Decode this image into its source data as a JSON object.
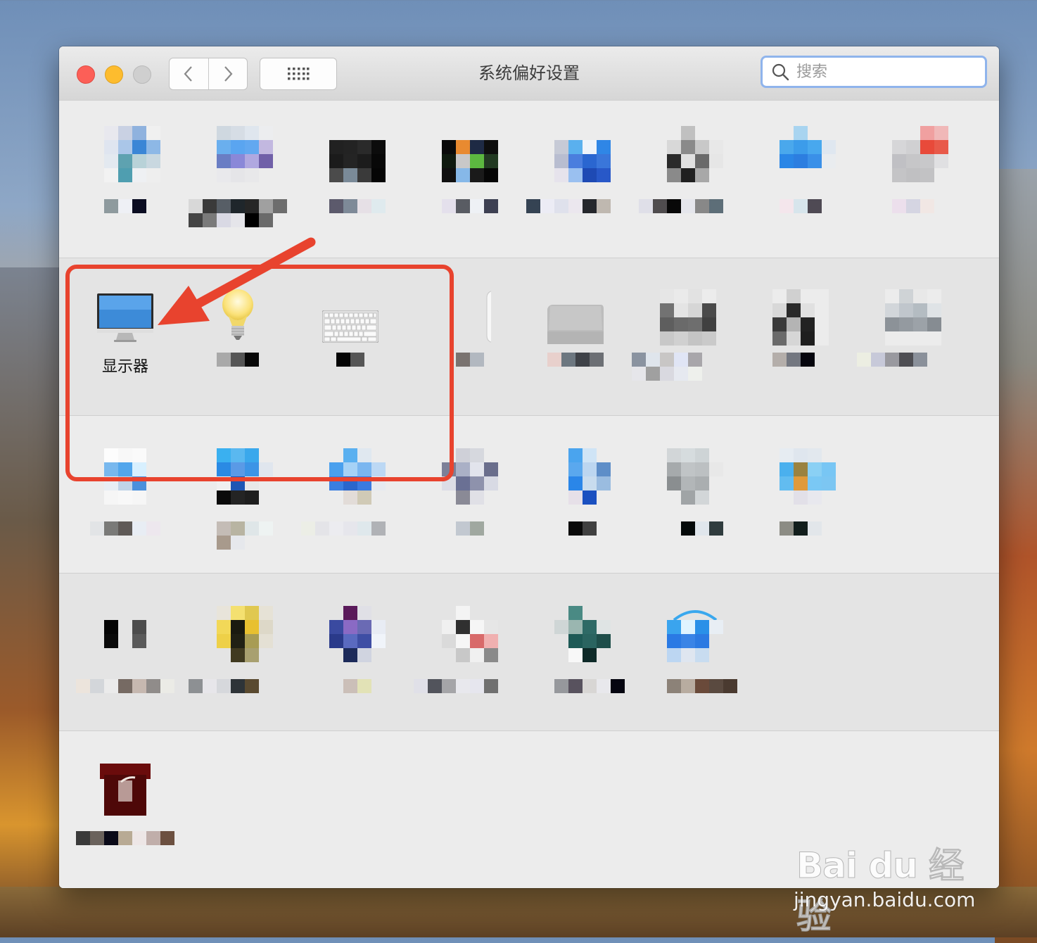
{
  "window": {
    "title": "系统偏好设置",
    "search_placeholder": "搜索"
  },
  "highlighted_pane": {
    "label": "显示器"
  },
  "watermark": {
    "logo": "Bai du 经验",
    "url": "jingyan.baidu.com"
  },
  "colors": {
    "highlight_box": "#e8432e",
    "arrow": "#e8432e",
    "search_focus_ring": "#8fb4ec"
  },
  "icons": {
    "display": "monitor-icon",
    "energy": "lightbulb-icon",
    "keyboard": "keyboard-icon",
    "mouse": "mouse-icon",
    "trackpad": "trackpad-icon"
  }
}
